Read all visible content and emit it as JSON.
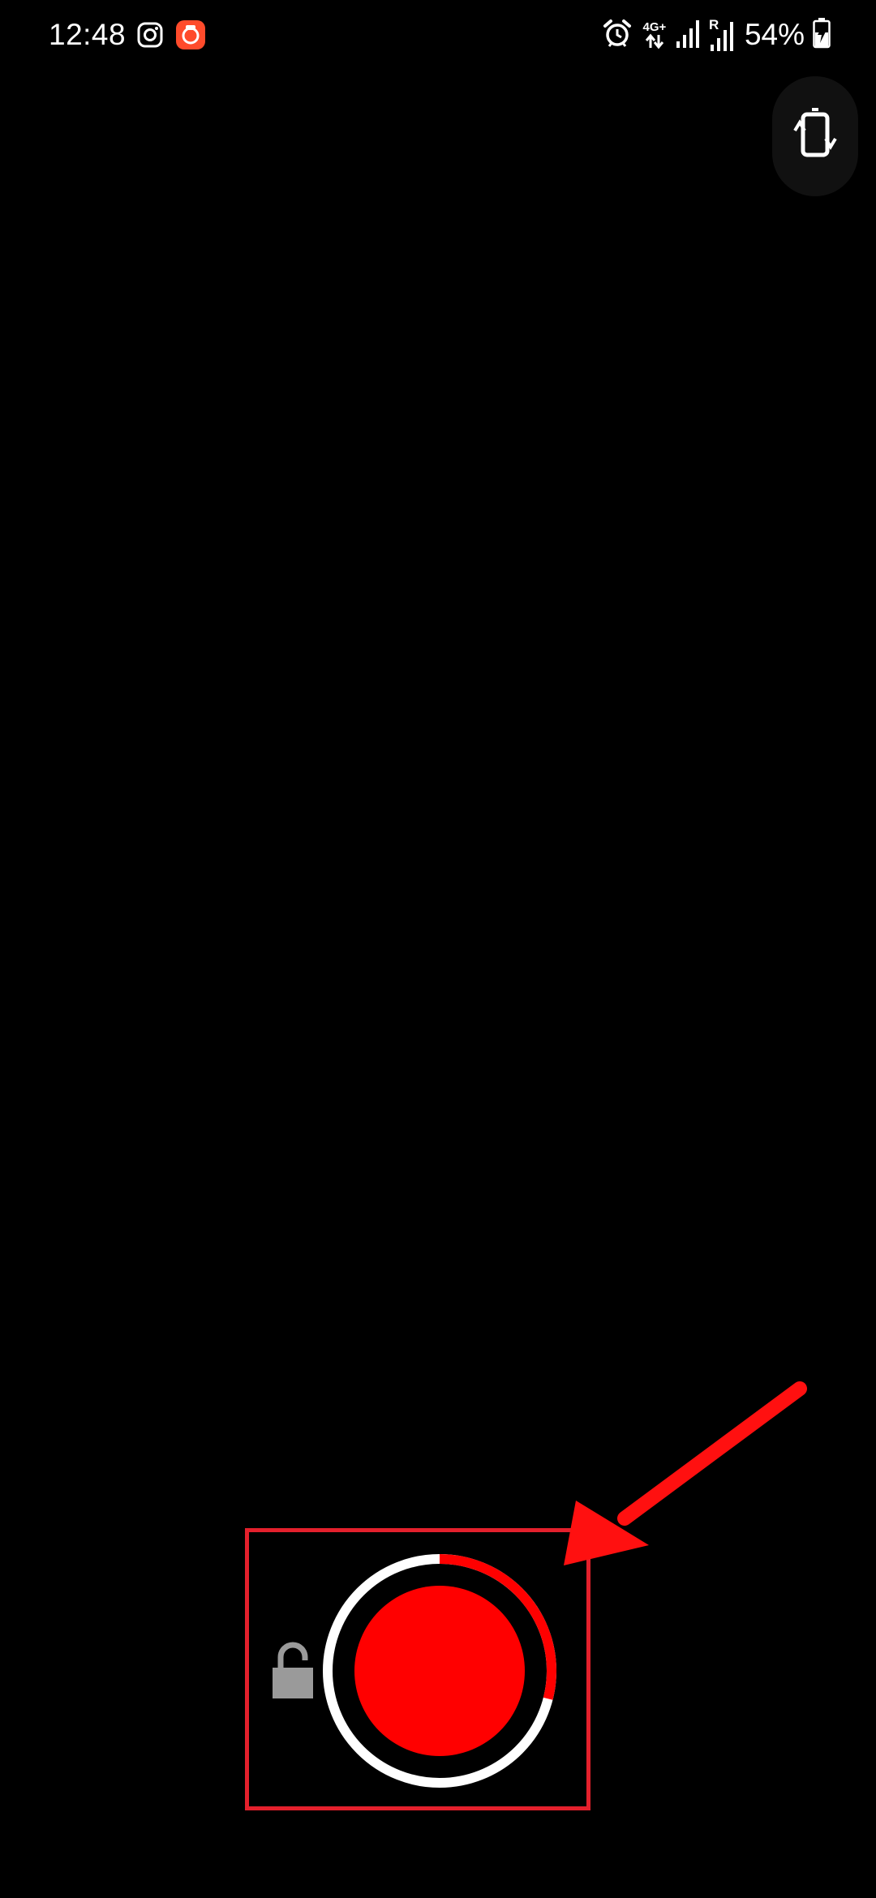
{
  "status_bar": {
    "time": "12:48",
    "battery_percent": "54%",
    "network_type": "4G+",
    "roaming_indicator": "R",
    "left_icons": [
      "instagram-icon",
      "camera-app-notification-icon"
    ],
    "right_icons": [
      "alarm-icon",
      "data-arrows-icon",
      "signal-icon",
      "signal-roaming-icon",
      "battery-charging-icon"
    ]
  },
  "camera_controls": {
    "icons": [
      "rotate-camera-icon",
      "lock-icon",
      "record-icon"
    ],
    "recording_progress": 0.29
  },
  "colors": {
    "background": "#000000",
    "record_red": "#ff0000",
    "ring_white": "#ffffff",
    "annotation_red": "#e4202c",
    "lock_gray": "#9a9a9a"
  }
}
